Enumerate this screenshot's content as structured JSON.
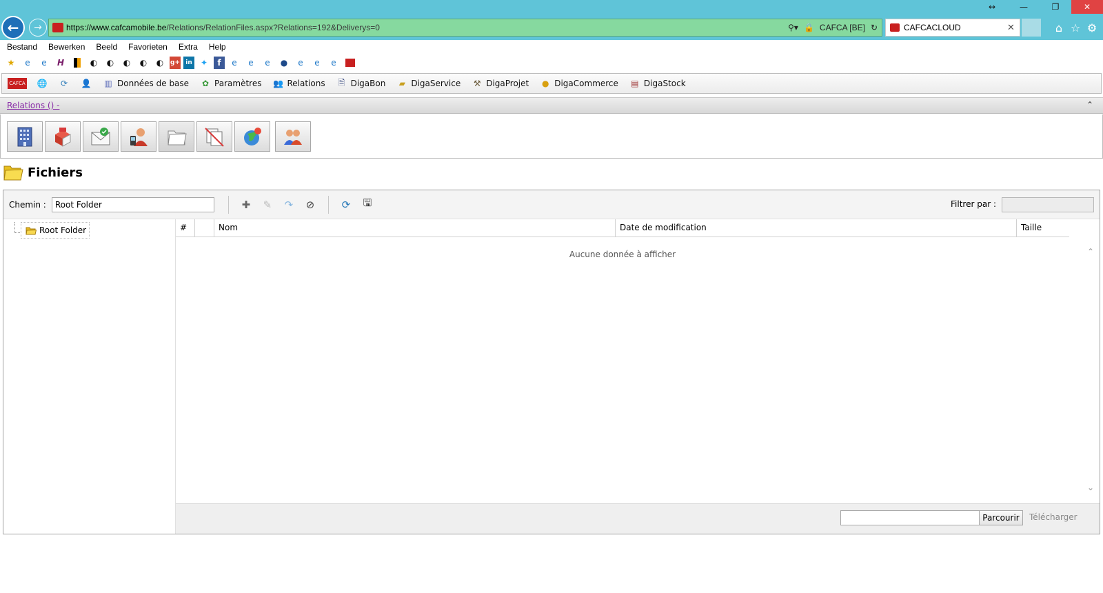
{
  "browser": {
    "url_domain": "https://www.cafcamobile.be",
    "url_rest": "/Relations/RelationFiles.aspx?Relations=192&Deliverys=0",
    "site_identity": "CAFCA [BE]",
    "tab_title": "CAFCACLOUD"
  },
  "menubar": [
    "Bestand",
    "Bewerken",
    "Beeld",
    "Favorieten",
    "Extra",
    "Help"
  ],
  "app_toolbar": {
    "logo_text": "CAFCA",
    "items": [
      "Données de base",
      "Paramètres",
      "Relations",
      "DigaBon",
      "DigaService",
      "DigaProjet",
      "DigaCommerce",
      "DigaStock"
    ]
  },
  "breadcrumb": "Relations () -",
  "page": {
    "title": "Fichiers"
  },
  "file_toolbar": {
    "path_label": "Chemin :",
    "path_value": "Root Folder",
    "filter_label": "Filtrer par :",
    "filter_value": ""
  },
  "tree": {
    "root": "Root Folder"
  },
  "grid": {
    "columns": [
      "#",
      "",
      "Nom",
      "Date de modification",
      "Taille"
    ],
    "empty_text": "Aucune donnée à afficher"
  },
  "footer": {
    "upload_value": "",
    "browse_label": "Parcourir",
    "download_label": "Télécharger"
  }
}
